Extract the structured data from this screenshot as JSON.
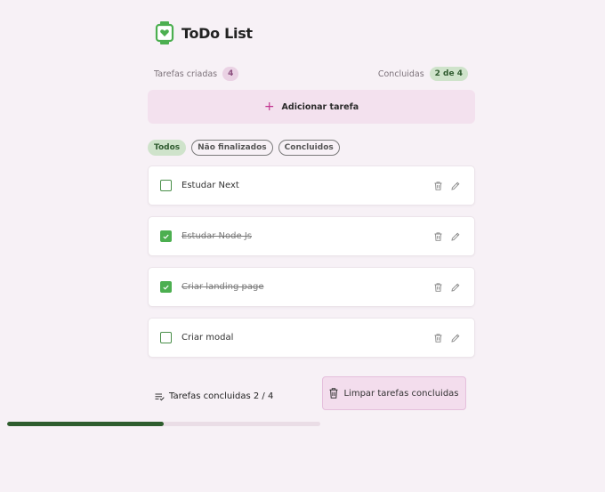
{
  "header": {
    "title": "ToDo List",
    "logo_icon": "watch-heart-icon"
  },
  "stats": {
    "created_label": "Tarefas criadas",
    "created_count": "4",
    "completed_label": "Concluidas",
    "completed_count": "2 de 4"
  },
  "add_task": {
    "label": "Adicionar tarefa",
    "icon": "plus-icon"
  },
  "filters": [
    {
      "label": "Todos",
      "active": true
    },
    {
      "label": "Não finalizados",
      "active": false
    },
    {
      "label": "Concluidos",
      "active": false
    }
  ],
  "tasks": [
    {
      "text": "Estudar Next",
      "done": false
    },
    {
      "text": "Estudar Node Js",
      "done": true
    },
    {
      "text": "Criar landing page",
      "done": true
    },
    {
      "text": "Criar modal",
      "done": false
    }
  ],
  "footer": {
    "summary": "Tarefas concluidas 2 / 4",
    "clear_label": "Limpar tarefas concluidas",
    "progress_fraction": 0.5
  },
  "colors": {
    "accent_green": "#4caf50",
    "accent_pink": "#c2338f",
    "progress_dark_green": "#2e5d2e"
  }
}
